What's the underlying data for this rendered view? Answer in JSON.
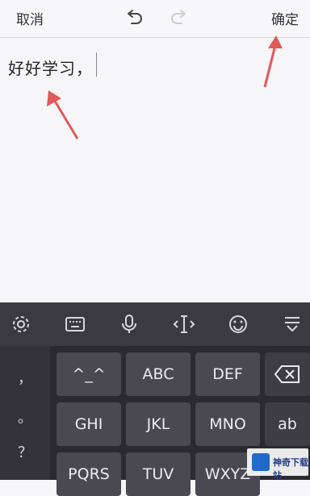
{
  "topbar": {
    "cancel_label": "取消",
    "confirm_label": "确定",
    "undo_icon": "undo-icon",
    "redo_icon": "redo-icon"
  },
  "editor": {
    "text": "好好学习，"
  },
  "keyboard": {
    "toolbar_icons": [
      "gear-icon",
      "keyboard-icon",
      "microphone-icon",
      "cursor-icon",
      "emoji-icon",
      "collapse-icon"
    ],
    "symbols": [
      "，",
      "。",
      "？"
    ],
    "keys": [
      "^_^",
      "ABC",
      "DEF",
      "GHI",
      "JKL",
      "MNO",
      "ab",
      "PQRS",
      "TUV",
      "WXYZ"
    ],
    "backspace_icon": "backspace-icon"
  },
  "watermark": {
    "text": "神奇下载站",
    "logo_icon": "site-logo-icon"
  },
  "colors": {
    "annotation_arrow": "#e05a5a",
    "keyboard_bg": "#2b2a31",
    "key_bg": "#4a4952"
  }
}
